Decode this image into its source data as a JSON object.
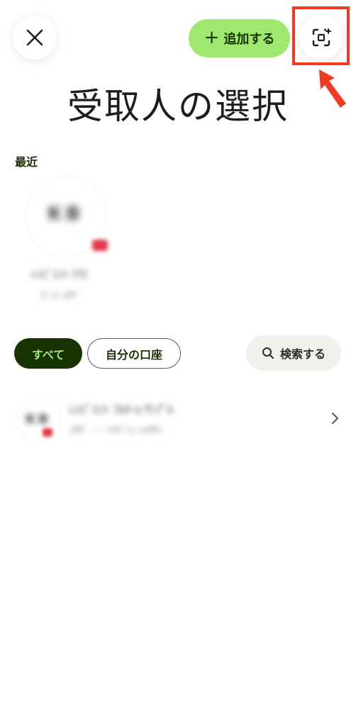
{
  "header": {
    "close_icon": "close-icon",
    "add_label": "追加する",
    "add_icon": "plus-icon",
    "scan_icon": "qr-scan-icon",
    "accent_color": "#9fe870",
    "highlight_color": "#f03a24"
  },
  "title": "受取人の選択",
  "recent": {
    "label": "最近",
    "contact": {
      "initials": "KB",
      "name": "ﾚｼﾋﾟｴﾝﾄ ﾅﾏｴ",
      "subtitle": "ｶﾞｲﾌﾞｺｳｻﾞ"
    }
  },
  "filters": {
    "all_label": "すべて",
    "own_label": "自分の口座",
    "search_label": "検索する",
    "search_icon": "search-icon",
    "active_color": "#163300"
  },
  "contacts": [
    {
      "initials": "KB",
      "name": "ﾚｼﾋﾟｴﾝﾄ ﾌﾙﾈｰﾑ ｻﾝﾌﾟﾙ",
      "subtitle": "ｺｳｻﾞ ･･･ ﾒｲｷﾞﾆﾝ ｼｮｳｻｲ"
    }
  ]
}
